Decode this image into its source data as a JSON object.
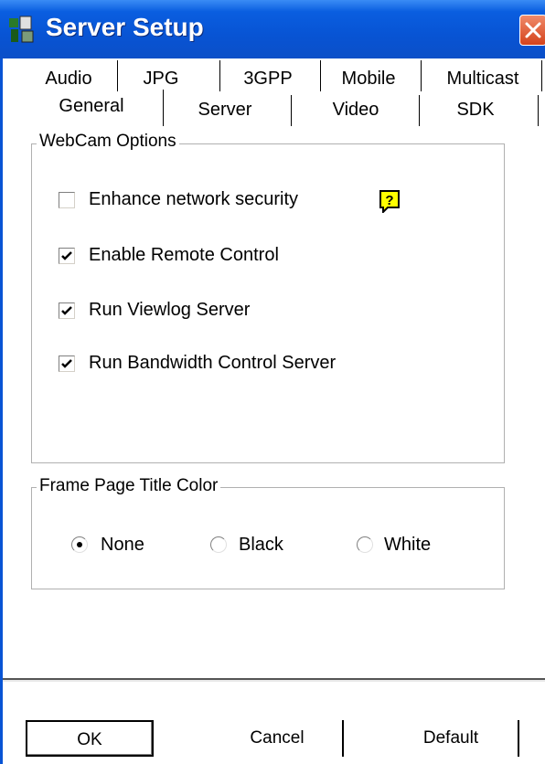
{
  "window": {
    "title": "Server Setup"
  },
  "tabs_row1": [
    "Audio",
    "JPG",
    "3GPP",
    "Mobile",
    "Multicast"
  ],
  "tabs_row2": [
    "General",
    "Server",
    "Video",
    "SDK"
  ],
  "active_tab": "General",
  "webcam_group": {
    "legend": "WebCam Options",
    "options": [
      {
        "label": "Enhance network security",
        "checked": false
      },
      {
        "label": "Enable Remote Control",
        "checked": true
      },
      {
        "label": "Run Viewlog Server",
        "checked": true
      },
      {
        "label": "Run Bandwidth Control Server",
        "checked": true
      }
    ]
  },
  "color_group": {
    "legend": "Frame Page Title Color",
    "options": [
      {
        "label": "None",
        "selected": true
      },
      {
        "label": "Black",
        "selected": false
      },
      {
        "label": "White",
        "selected": false
      }
    ]
  },
  "buttons": {
    "ok": "OK",
    "cancel": "Cancel",
    "default": "Default"
  },
  "colors": {
    "titlebar": "#0854d4",
    "close": "#d4431c",
    "help": "#ffff00"
  }
}
